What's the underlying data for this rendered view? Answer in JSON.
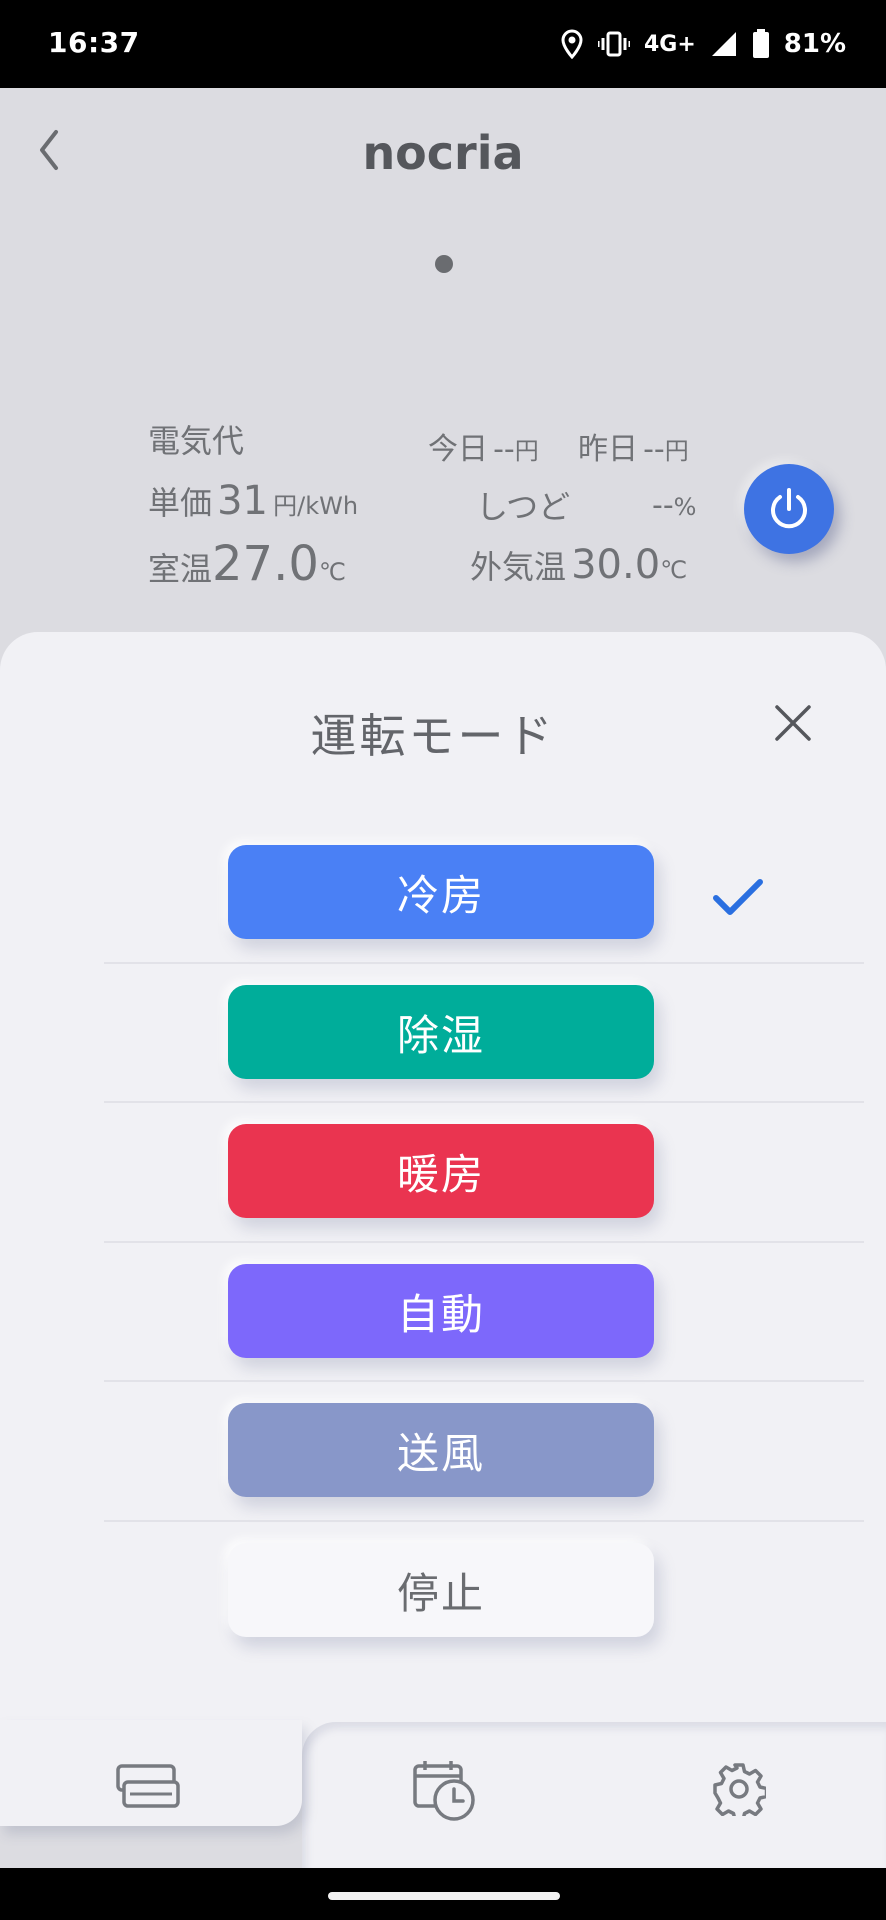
{
  "status_bar": {
    "time": "16:37",
    "network": "4G+",
    "battery": "81%",
    "icons": [
      "location-icon",
      "vibrate-icon",
      "signal-icon",
      "battery-icon"
    ]
  },
  "header": {
    "title": "nocria",
    "back_icon": "chevron-left-icon"
  },
  "info": {
    "electricity_label": "電気代",
    "today_label": "今日",
    "today_value": "--",
    "today_unit": "円",
    "yesterday_label": "昨日",
    "yesterday_value": "--",
    "yesterday_unit": "円",
    "unit_price_label": "単価",
    "unit_price_value": "31",
    "unit_price_unit": "円/kWh",
    "humidity_label": "しつど",
    "humidity_value": "--",
    "humidity_unit": "%",
    "room_temp_label": "室温",
    "room_temp_value": "27.0",
    "room_temp_unit": "℃",
    "outdoor_temp_label": "外気温",
    "outdoor_temp_value": "30.0",
    "outdoor_temp_unit": "℃"
  },
  "power_button": {
    "icon": "power-icon",
    "color": "#3e73e3"
  },
  "sheet": {
    "title": "運転モード",
    "close_icon": "close-icon",
    "selected_mode": "冷房",
    "modes": [
      {
        "label": "冷房",
        "color": "#4a80f5",
        "selected": true
      },
      {
        "label": "除湿",
        "color": "#00ad9a"
      },
      {
        "label": "暖房",
        "color": "#ea3450"
      },
      {
        "label": "自動",
        "color": "#7d68fb"
      },
      {
        "label": "送風",
        "color": "#8897c9"
      },
      {
        "label": "停止",
        "color": "#f7f7fa"
      }
    ]
  },
  "tabs": [
    {
      "icon": "aircon-icon",
      "selected": true
    },
    {
      "icon": "schedule-icon"
    },
    {
      "icon": "gear-icon"
    }
  ]
}
